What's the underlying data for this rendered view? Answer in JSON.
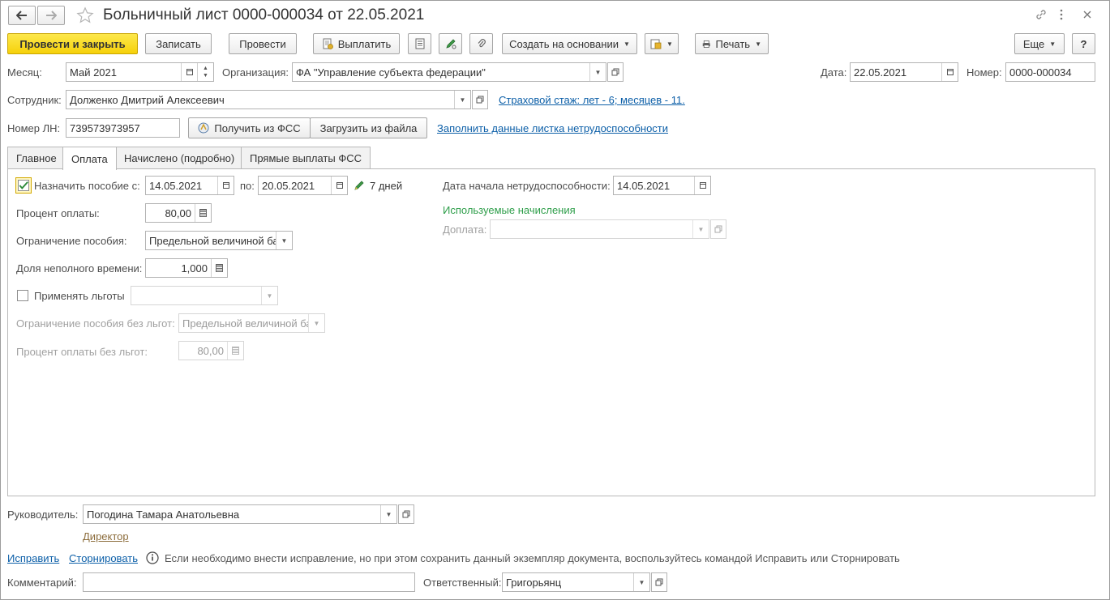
{
  "window": {
    "title": "Больничный лист 0000-000034 от 22.05.2021"
  },
  "toolbar": {
    "post_close": "Провести и закрыть",
    "save": "Записать",
    "post": "Провести",
    "pay": "Выплатить",
    "create_based_on": "Создать на основании",
    "print": "Печать",
    "more": "Еще",
    "help": "?"
  },
  "header": {
    "month_label": "Месяц:",
    "month_value": "Май 2021",
    "org_label": "Организация:",
    "org_value": "ФА \"Управление субъекта федерации\"",
    "date_label": "Дата:",
    "date_value": "22.05.2021",
    "number_label": "Номер:",
    "number_value": "0000-000034",
    "employee_label": "Сотрудник:",
    "employee_value": "Долженко Дмитрий Алексеевич",
    "insurance_link": "Страховой стаж: лет - 6; месяцев - 11.",
    "ln_label": "Номер ЛН:",
    "ln_value": "739573973957",
    "get_fss": "Получить из ФСС",
    "load_file": "Загрузить из файла",
    "fill_link": "Заполнить данные листка нетрудоспособности"
  },
  "tabs": [
    {
      "label": "Главное"
    },
    {
      "label": "Оплата"
    },
    {
      "label": "Начислено (подробно)"
    },
    {
      "label": "Прямые выплаты ФСС"
    }
  ],
  "payment": {
    "assign_label": "Назначить пособие с:",
    "assign_checked": true,
    "date_from": "14.05.2021",
    "to_label": "по:",
    "date_to": "20.05.2021",
    "days": "7 дней",
    "percent_label": "Процент оплаты:",
    "percent_value": "80,00",
    "limit_label": "Ограничение пособия:",
    "limit_value": "Предельной величиной ба",
    "parttime_label": "Доля неполного времени:",
    "parttime_value": "1,000",
    "benefits_label": "Применять льготы",
    "benefits_checked": false,
    "limit_nobenefits_label": "Ограничение пособия без льгот:",
    "limit_nobenefits_value": "Предельной величиной ба",
    "percent_nobenefits_label": "Процент оплаты без льгот:",
    "percent_nobenefits_value": "80,00",
    "disability_start_label": "Дата начала нетрудоспособности:",
    "disability_start_value": "14.05.2021",
    "used_accruals": "Используемые начисления",
    "surcharge_label": "Доплата:",
    "surcharge_value": ""
  },
  "footer": {
    "manager_label": "Руководитель:",
    "manager_value": "Погодина Тамара Анатольевна",
    "manager_position": "Директор",
    "fix_link": "Исправить",
    "reverse_link": "Сторнировать",
    "info_text": "Если необходимо внести исправление, но при этом сохранить данный экземпляр документа, воспользуйтесь командой Исправить или Сторнировать",
    "comment_label": "Комментарий:",
    "comment_value": "",
    "responsible_label": "Ответственный:",
    "responsible_value": "Григорьянц"
  },
  "colors": {
    "primary_button": "#f6d10a",
    "link": "#0c5fa8",
    "green_caption": "#2e9e4a",
    "check_mark": "#2e8b3a"
  }
}
